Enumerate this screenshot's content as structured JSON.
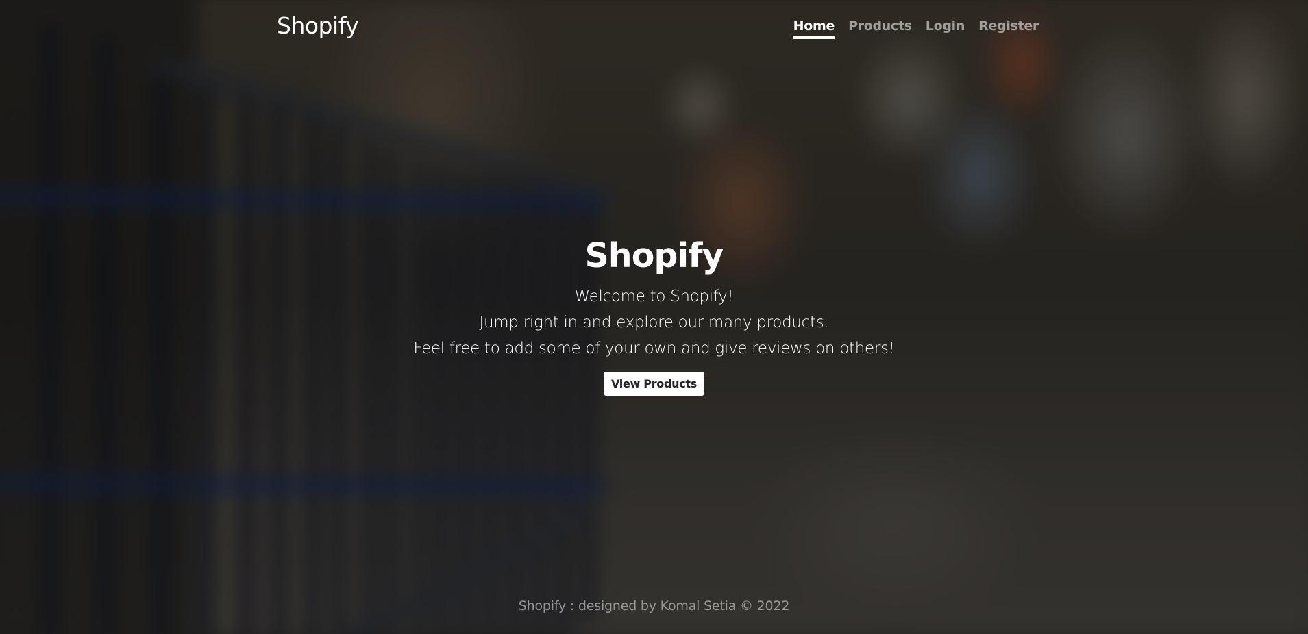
{
  "nav": {
    "brand": "Shopify",
    "links": [
      {
        "label": "Home"
      },
      {
        "label": "Products"
      },
      {
        "label": "Login"
      },
      {
        "label": "Register"
      }
    ]
  },
  "hero": {
    "title": "Shopify",
    "lines": [
      "Welcome to Shopify!",
      "Jump right in and explore our many products.",
      "Feel free to add some of your own and give reviews on others!"
    ],
    "button_label": "View Products"
  },
  "footer": {
    "text": "Shopify : designed by Komal Setia © 2022"
  },
  "colors": {
    "text": "#ffffff",
    "nav_inactive": "rgba(255,255,255,0.55)",
    "button_bg": "#ffffff",
    "button_text": "#212529"
  }
}
